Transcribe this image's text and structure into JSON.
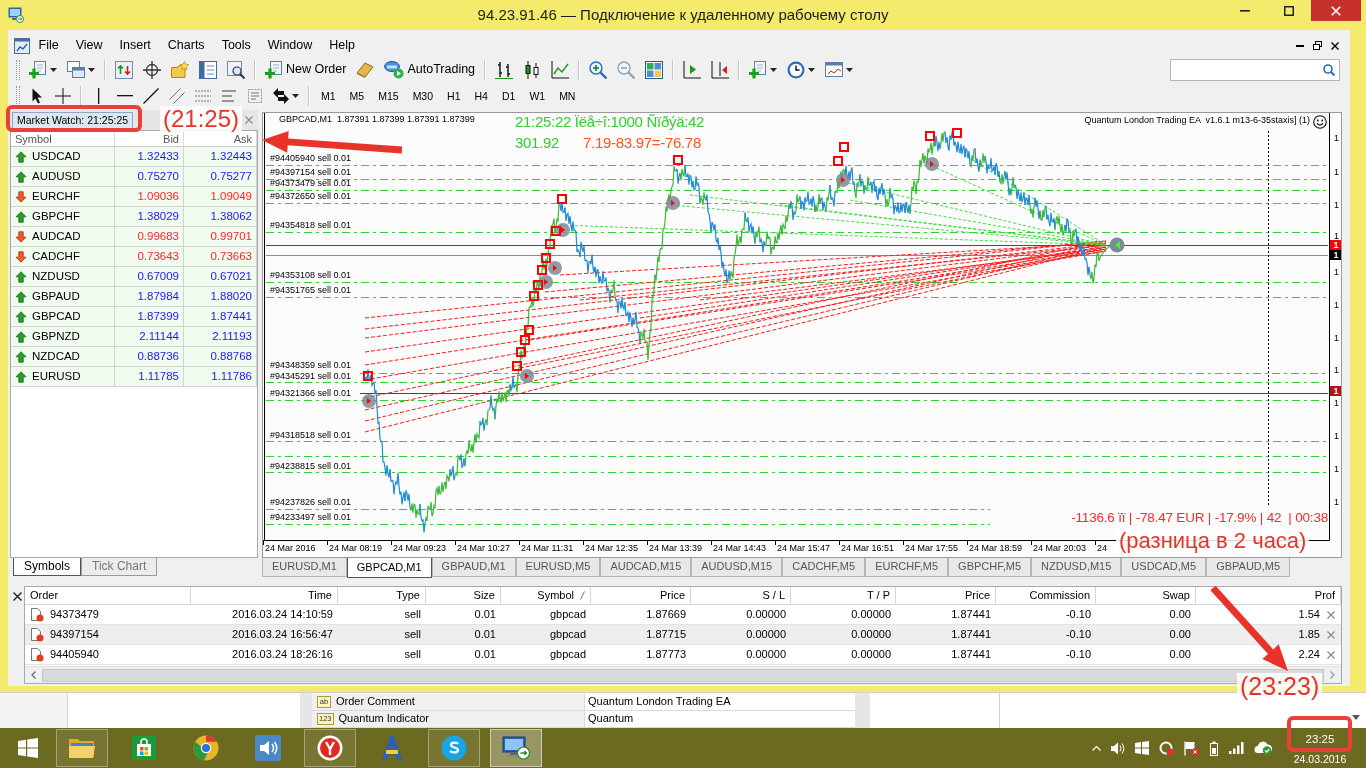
{
  "window": {
    "title": "94.23.91.46 — Подключение к удаленному рабочему столу"
  },
  "menu": [
    "File",
    "View",
    "Insert",
    "Charts",
    "Tools",
    "Window",
    "Help"
  ],
  "toolbar": {
    "new_order": "New Order",
    "autotrading": "AutoTrading"
  },
  "timeframes": [
    "M1",
    "M5",
    "M15",
    "M30",
    "H1",
    "H4",
    "D1",
    "W1",
    "MN"
  ],
  "market_watch": {
    "title": "Market Watch: 21:25:25",
    "columns": [
      "Symbol",
      "Bid",
      "Ask"
    ],
    "rows": [
      {
        "symbol": "USDCAD",
        "bid": "1.32433",
        "ask": "1.32443",
        "rising": true
      },
      {
        "symbol": "AUDUSD",
        "bid": "0.75270",
        "ask": "0.75277",
        "rising": true
      },
      {
        "symbol": "EURCHF",
        "bid": "1.09036",
        "ask": "1.09049",
        "rising": false
      },
      {
        "symbol": "GBPCHF",
        "bid": "1.38029",
        "ask": "1.38062",
        "rising": true
      },
      {
        "symbol": "AUDCAD",
        "bid": "0.99683",
        "ask": "0.99701",
        "rising": false
      },
      {
        "symbol": "CADCHF",
        "bid": "0.73643",
        "ask": "0.73663",
        "rising": false
      },
      {
        "symbol": "NZDUSD",
        "bid": "0.67009",
        "ask": "0.67021",
        "rising": true
      },
      {
        "symbol": "GBPAUD",
        "bid": "1.87984",
        "ask": "1.88020",
        "rising": true
      },
      {
        "symbol": "GBPCAD",
        "bid": "1.87399",
        "ask": "1.87441",
        "rising": true
      },
      {
        "symbol": "GBPNZD",
        "bid": "2.11144",
        "ask": "2.11193",
        "rising": true
      },
      {
        "symbol": "NZDCAD",
        "bid": "0.88736",
        "ask": "0.88768",
        "rising": true
      },
      {
        "symbol": "EURUSD",
        "bid": "1.11785",
        "ask": "1.11786",
        "rising": true
      }
    ],
    "tabs": [
      {
        "label": "Symbols",
        "selected": true
      },
      {
        "label": "Tick Chart",
        "selected": false
      }
    ]
  },
  "chart": {
    "header": "GBPCAD,M1  1.87391 1.87399 1.87391 1.87399",
    "status_line": "21:25:22 Ïëå÷î:1000 Ñïðýä:42",
    "balance": "301.92",
    "result": "7.19-83.97=-76.78",
    "expert": "Quantum London Trading EA  v1.6.1 m13-6-35staxis] (1)",
    "order_labels": [
      "#94405940 sell 0.01",
      "#94397154 sell 0.01",
      "#94373479 sell 0.01",
      "#94372650 sell 0.01",
      "#94354818 sell 0.01",
      "#94353108 sell 0.01",
      "#94351765 sell 0.01",
      "#94348359 sell 0.01",
      "#94345291 sell 0.01",
      "#94321366 sell 0.01",
      "#94318518 sell 0.01",
      "#94238815 sell 0.01",
      "#94237826 sell 0.01",
      "#94233497 sell 0.01"
    ],
    "price_axis": [
      "1",
      "1",
      "1",
      "1",
      "1",
      "1",
      "1",
      "1",
      "1",
      "1",
      "1",
      "1"
    ],
    "price_tags": [
      {
        "label": "1",
        "color": "#ff0000"
      },
      {
        "label": "1",
        "color": "#000000"
      },
      {
        "label": "1",
        "color": "#b01818"
      }
    ],
    "time_axis": [
      "24 Mar 2016",
      "24 Mar 08:19",
      "24 Mar 09:23",
      "24 Mar 10:27",
      "24 Mar 11:31",
      "24 Mar 12:35",
      "24 Mar 13:39",
      "24 Mar 14:43",
      "24 Mar 15:47",
      "24 Mar 16:51",
      "24 Mar 17:55",
      "24 Mar 18:59",
      "24 Mar 20:03",
      "24"
    ],
    "footer": "-1136.6 ïï | -78.47 EUR | -17.9% | 42  | 00:38"
  },
  "chart_tabs": [
    {
      "label": "EURUSD,M1",
      "selected": false
    },
    {
      "label": "GBPCAD,M1",
      "selected": true
    },
    {
      "label": "GBPAUD,M1",
      "selected": false
    },
    {
      "label": "EURUSD,M5",
      "selected": false
    },
    {
      "label": "AUDCAD,M15",
      "selected": false
    },
    {
      "label": "AUDUSD,M15",
      "selected": false
    },
    {
      "label": "CADCHF,M5",
      "selected": false
    },
    {
      "label": "EURCHF,M5",
      "selected": false
    },
    {
      "label": "GBPCHF,M5",
      "selected": false
    },
    {
      "label": "NZDUSD,M15",
      "selected": false
    },
    {
      "label": "USDCAD,M5",
      "selected": false
    },
    {
      "label": "GBPAUD,M5",
      "selected": false
    }
  ],
  "terminal": {
    "columns": [
      {
        "label": "Order",
        "sorted": false
      },
      {
        "label": "Time",
        "sorted": false
      },
      {
        "label": "Type",
        "sorted": false
      },
      {
        "label": "Size",
        "sorted": false
      },
      {
        "label": "Symbol",
        "sorted": true
      },
      {
        "label": "Price",
        "sorted": false
      },
      {
        "label": "S / L",
        "sorted": false
      },
      {
        "label": "T / P",
        "sorted": false
      },
      {
        "label": "Price",
        "sorted": false
      },
      {
        "label": "Commission",
        "sorted": false
      },
      {
        "label": "Swap",
        "sorted": false
      },
      {
        "label": "Prof",
        "sorted": false
      }
    ],
    "rows": [
      [
        "94373479",
        "2016.03.24 14:10:59",
        "sell",
        "0.01",
        "gbpcad",
        "1.87669",
        "0.00000",
        "0.00000",
        "1.87441",
        "-0.10",
        "0.00",
        "1.54"
      ],
      [
        "94397154",
        "2016.03.24 16:56:47",
        "sell",
        "0.01",
        "gbpcad",
        "1.87715",
        "0.00000",
        "0.00000",
        "1.87441",
        "-0.10",
        "0.00",
        "1.85"
      ],
      [
        "94405940",
        "2016.03.24 18:26:16",
        "sell",
        "0.01",
        "gbpcad",
        "1.87773",
        "0.00000",
        "0.00000",
        "1.87441",
        "-0.10",
        "0.00",
        "2.24"
      ]
    ]
  },
  "background_window": {
    "rows": [
      {
        "type_tag": "ab",
        "name": "Order Comment",
        "value": "Quantum London Trading EA"
      },
      {
        "type_tag": "123",
        "name": "Quantum Indicator",
        "value": "Quantum"
      }
    ]
  },
  "taskbar": {
    "apps": [
      {
        "kind": "folder",
        "running": true,
        "focused": false
      },
      {
        "kind": "store",
        "running": false,
        "focused": false
      },
      {
        "kind": "wheel",
        "running": false,
        "focused": false
      },
      {
        "kind": "speaker",
        "running": false,
        "focused": false
      },
      {
        "kind": "fork",
        "running": true,
        "focused": false
      },
      {
        "kind": "tower",
        "running": false,
        "focused": false
      },
      {
        "kind": "wave",
        "running": true,
        "focused": false
      },
      {
        "kind": "monitor",
        "running": true,
        "focused": true
      }
    ],
    "time": "23:25",
    "date": "24.03.2016"
  },
  "annotations": [
    "(21:25)",
    "(разница в 2 часа)",
    "(23:23)"
  ]
}
